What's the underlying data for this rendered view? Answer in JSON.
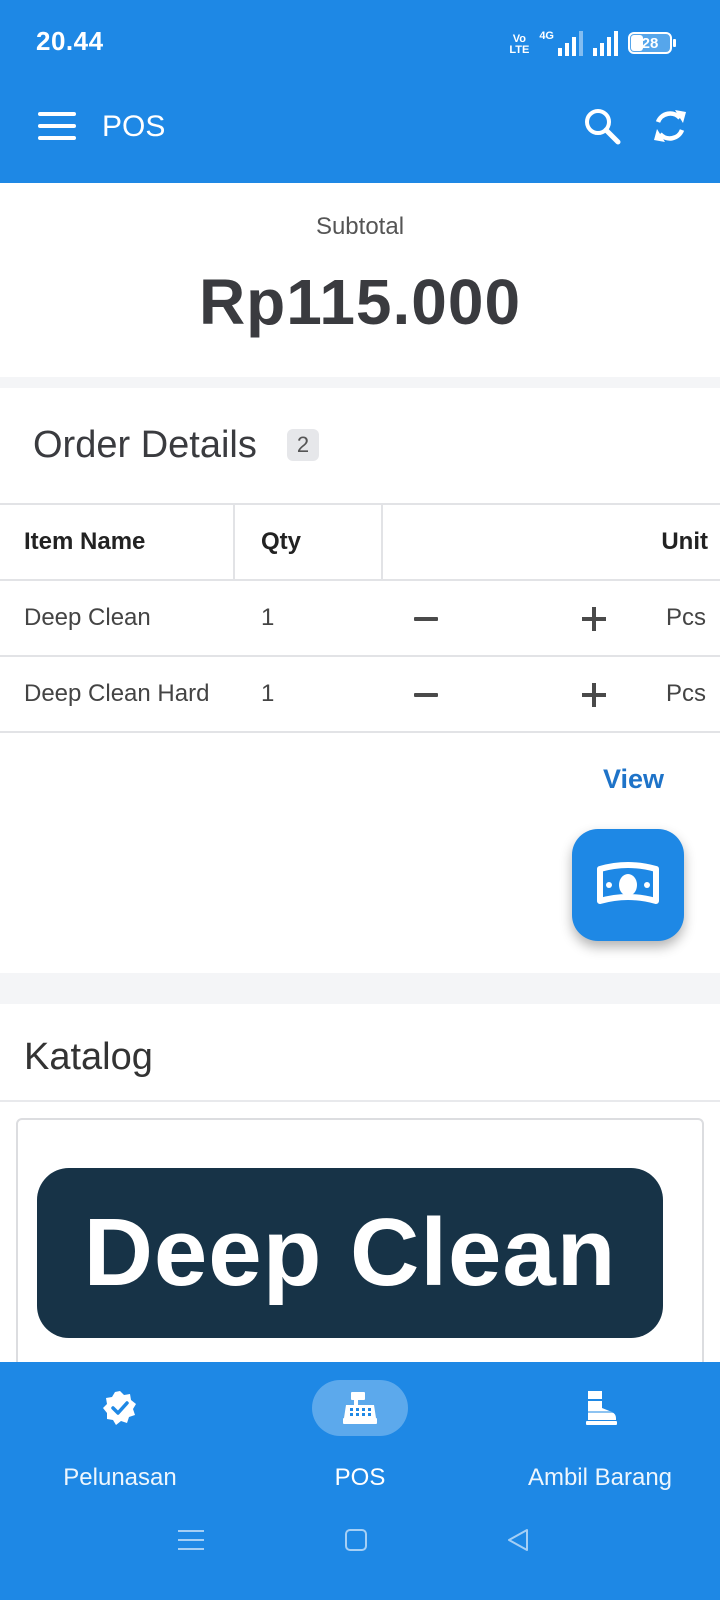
{
  "status_bar": {
    "time": "20.44",
    "volte_top": "Vo",
    "volte_bottom": "LTE",
    "network": "4G",
    "battery": "28"
  },
  "app_bar": {
    "title": "POS",
    "icons": [
      "menu-icon",
      "search-icon",
      "refresh-icon"
    ]
  },
  "subtotal": {
    "label": "Subtotal",
    "value": "Rp115.000"
  },
  "order_details": {
    "title": "Order Details",
    "count": "2",
    "columns": {
      "name": "Item Name",
      "qty": "Qty",
      "unit": "Unit"
    },
    "rows": [
      {
        "name": "Deep Clean",
        "qty": "1",
        "unit": "Pcs"
      },
      {
        "name": "Deep Clean Hard",
        "qty": "1",
        "unit": "Pcs"
      }
    ],
    "view_label": "View",
    "fab_icon": "money-icon"
  },
  "katalog": {
    "title": "Katalog",
    "items": [
      {
        "banner_text": "Deep Clean"
      }
    ]
  },
  "bottom_nav": {
    "items": [
      {
        "label": "Pelunasan",
        "icon": "verified-badge-icon",
        "active": false
      },
      {
        "label": "POS",
        "icon": "cash-register-icon",
        "active": true
      },
      {
        "label": "Ambil Barang",
        "icon": "boot-icon",
        "active": false
      }
    ]
  },
  "colors": {
    "primary": "#1e88e5",
    "link": "#1e73c8",
    "banner_bg": "#173347"
  }
}
